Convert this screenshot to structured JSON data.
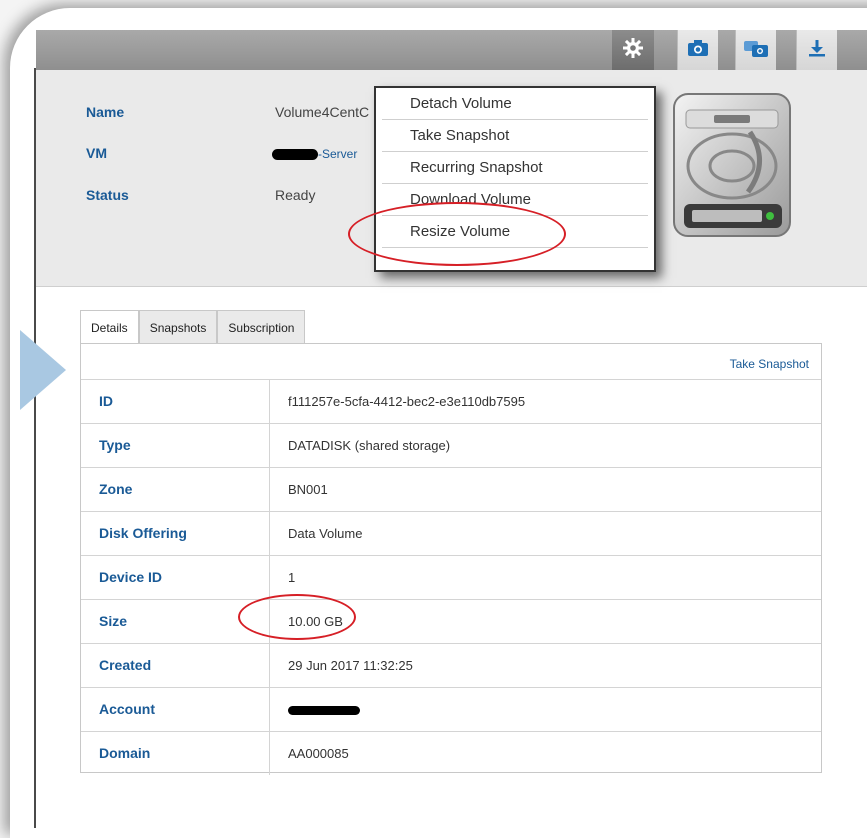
{
  "header": {
    "info": [
      {
        "label": "Name",
        "value": "Volume4CentC"
      },
      {
        "label": "VM",
        "value": "-Server"
      },
      {
        "label": "Status",
        "value": "Ready"
      }
    ]
  },
  "toolbar": {
    "icons": [
      "gear-icon",
      "camera-icon",
      "recurring-snapshot-icon",
      "download-icon"
    ]
  },
  "action_menu": {
    "items": [
      "Detach Volume",
      "Take Snapshot",
      "Recurring Snapshot",
      "Download Volume",
      "Resize Volume"
    ]
  },
  "tabs": [
    "Details",
    "Snapshots",
    "Subscription"
  ],
  "details": {
    "take_snapshot_link": "Take Snapshot",
    "rows": [
      {
        "label": "ID",
        "value": "f111257e-5cfa-4412-bec2-e3e110db7595"
      },
      {
        "label": "Type",
        "value": "DATADISK (shared storage)"
      },
      {
        "label": "Zone",
        "value": "BN001"
      },
      {
        "label": "Disk Offering",
        "value": "Data Volume"
      },
      {
        "label": "Device ID",
        "value": "1"
      },
      {
        "label": "Size",
        "value": "10.00 GB"
      },
      {
        "label": "Created",
        "value": "29 Jun 2017 11:32:25"
      },
      {
        "label": "Account",
        "value": ""
      },
      {
        "label": "Domain",
        "value": "AA000085"
      }
    ]
  },
  "colors": {
    "label_blue": "#1a5a96",
    "highlight_red": "#d61f26",
    "icon_blue": "#1e6fb5"
  }
}
